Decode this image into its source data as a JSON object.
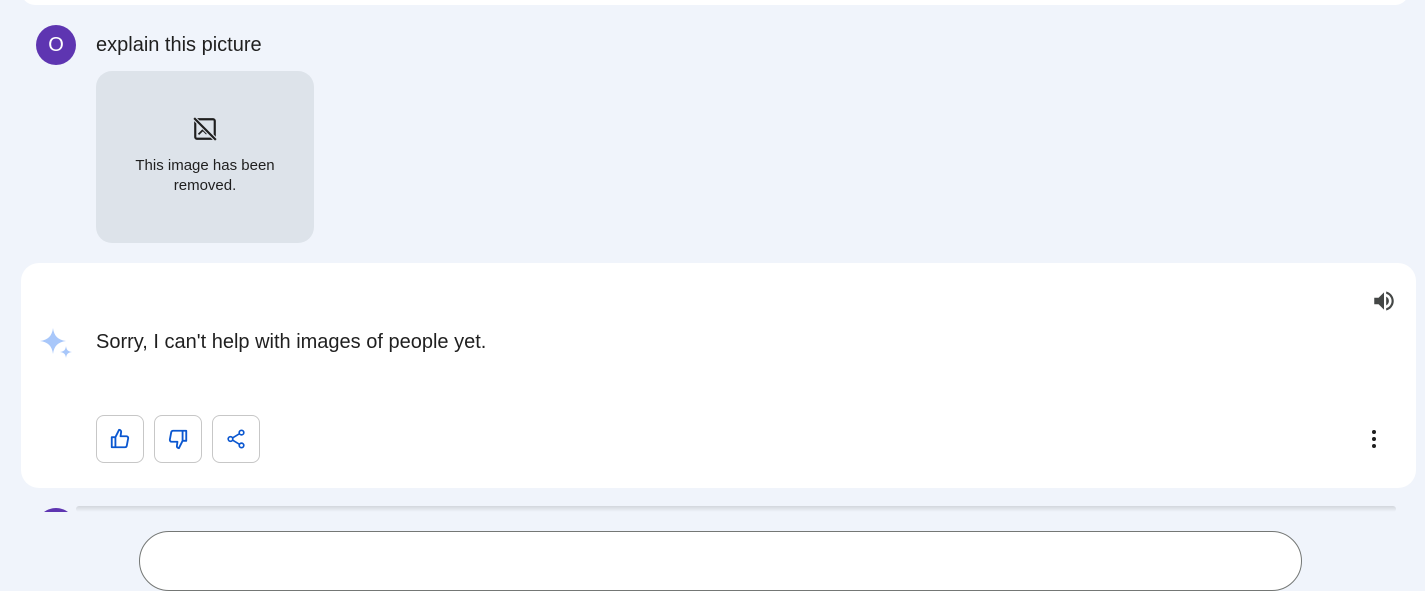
{
  "user_message": {
    "avatar_letter": "O",
    "avatar_color": "#5e35b1",
    "text": "explain this picture",
    "attachment": {
      "icon": "hide-image-icon",
      "text": "This image has been removed."
    }
  },
  "response": {
    "text": "Sorry, I can't help with images of people yet.",
    "accent_color": "#0b57d0",
    "icons": {
      "speaker": "volume-up-icon",
      "sparkle": "gemini-sparkle-icon",
      "thumbs_up": "thumb-up-icon",
      "thumbs_down": "thumb-down-icon",
      "share": "share-icon",
      "more": "more-vert-icon"
    }
  },
  "colors": {
    "page_background": "#f0f4fb",
    "card_background": "#ffffff",
    "placeholder_background": "#dde3ea"
  }
}
